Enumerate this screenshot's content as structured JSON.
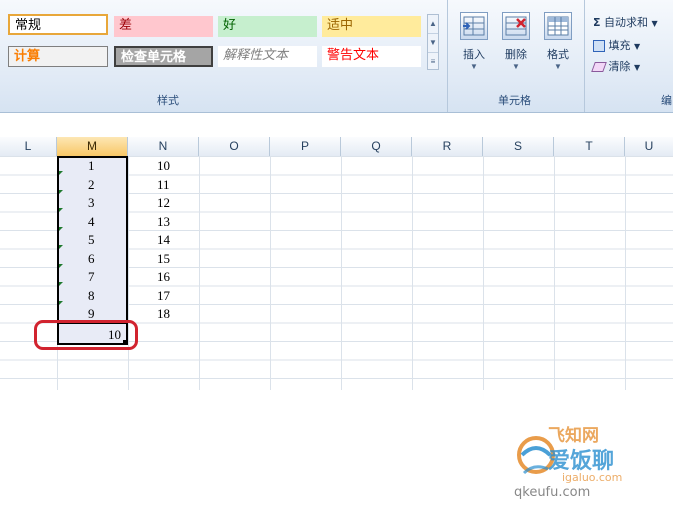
{
  "styles": {
    "normal": "常规",
    "bad": "差",
    "good": "好",
    "neutral": "适中",
    "calculation": "计算",
    "check_cell": "检查单元格",
    "explanatory": "解释性文本",
    "warning": "警告文本",
    "group_label": "样式"
  },
  "cells_group": {
    "insert": "插入",
    "delete": "删除",
    "format": "格式",
    "group_label": "单元格"
  },
  "editing": {
    "autosum": "自动求和",
    "fill": "填充",
    "clear": "清除",
    "group_label_partial": "编"
  },
  "columns": [
    "L",
    "M",
    "N",
    "O",
    "P",
    "Q",
    "R",
    "S",
    "T",
    "U"
  ],
  "selected_column": "M",
  "column_m": [
    "1",
    "2",
    "3",
    "4",
    "5",
    "6",
    "7",
    "8",
    "9"
  ],
  "column_n": [
    "10",
    "11",
    "12",
    "13",
    "14",
    "15",
    "16",
    "17",
    "18"
  ],
  "sum_value": "10",
  "watermark": {
    "line1": "飞知网",
    "line2": "爱饭聊",
    "line3": "igaluo.com",
    "line4": "qkeufu.com"
  },
  "colors": {
    "bad_bg": "#ffc7ce",
    "good_bg": "#c6efce",
    "neutral_bg": "#ffeb9c",
    "highlight_red": "#d1232f"
  }
}
